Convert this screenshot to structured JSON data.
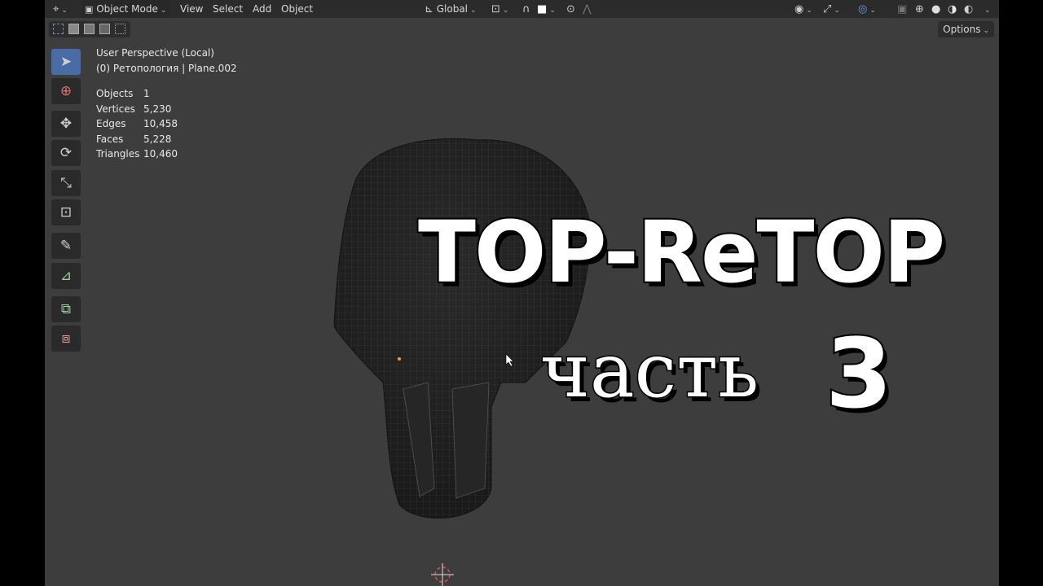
{
  "header": {
    "mode_label": "Object Mode",
    "menus": [
      "View",
      "Select",
      "Add",
      "Object"
    ],
    "orientation_label": "Global"
  },
  "tool_settings": {
    "options_label": "Options"
  },
  "viewport": {
    "perspective_label": "User Perspective (Local)",
    "object_label": "(0) Ретопология | Plane.002",
    "stats": [
      {
        "label": "Objects",
        "value": "1"
      },
      {
        "label": "Vertices",
        "value": "5,230"
      },
      {
        "label": "Edges",
        "value": "10,458"
      },
      {
        "label": "Faces",
        "value": "5,228"
      },
      {
        "label": "Triangles",
        "value": "10,460"
      }
    ]
  },
  "title": {
    "main": "TOP-ReTOP",
    "part_word": "часть",
    "part_number": "3"
  },
  "colors": {
    "viewport_bg": "#3d3d3d",
    "header_bg": "#2b2b2b",
    "active_tool": "#4a6ca6"
  }
}
